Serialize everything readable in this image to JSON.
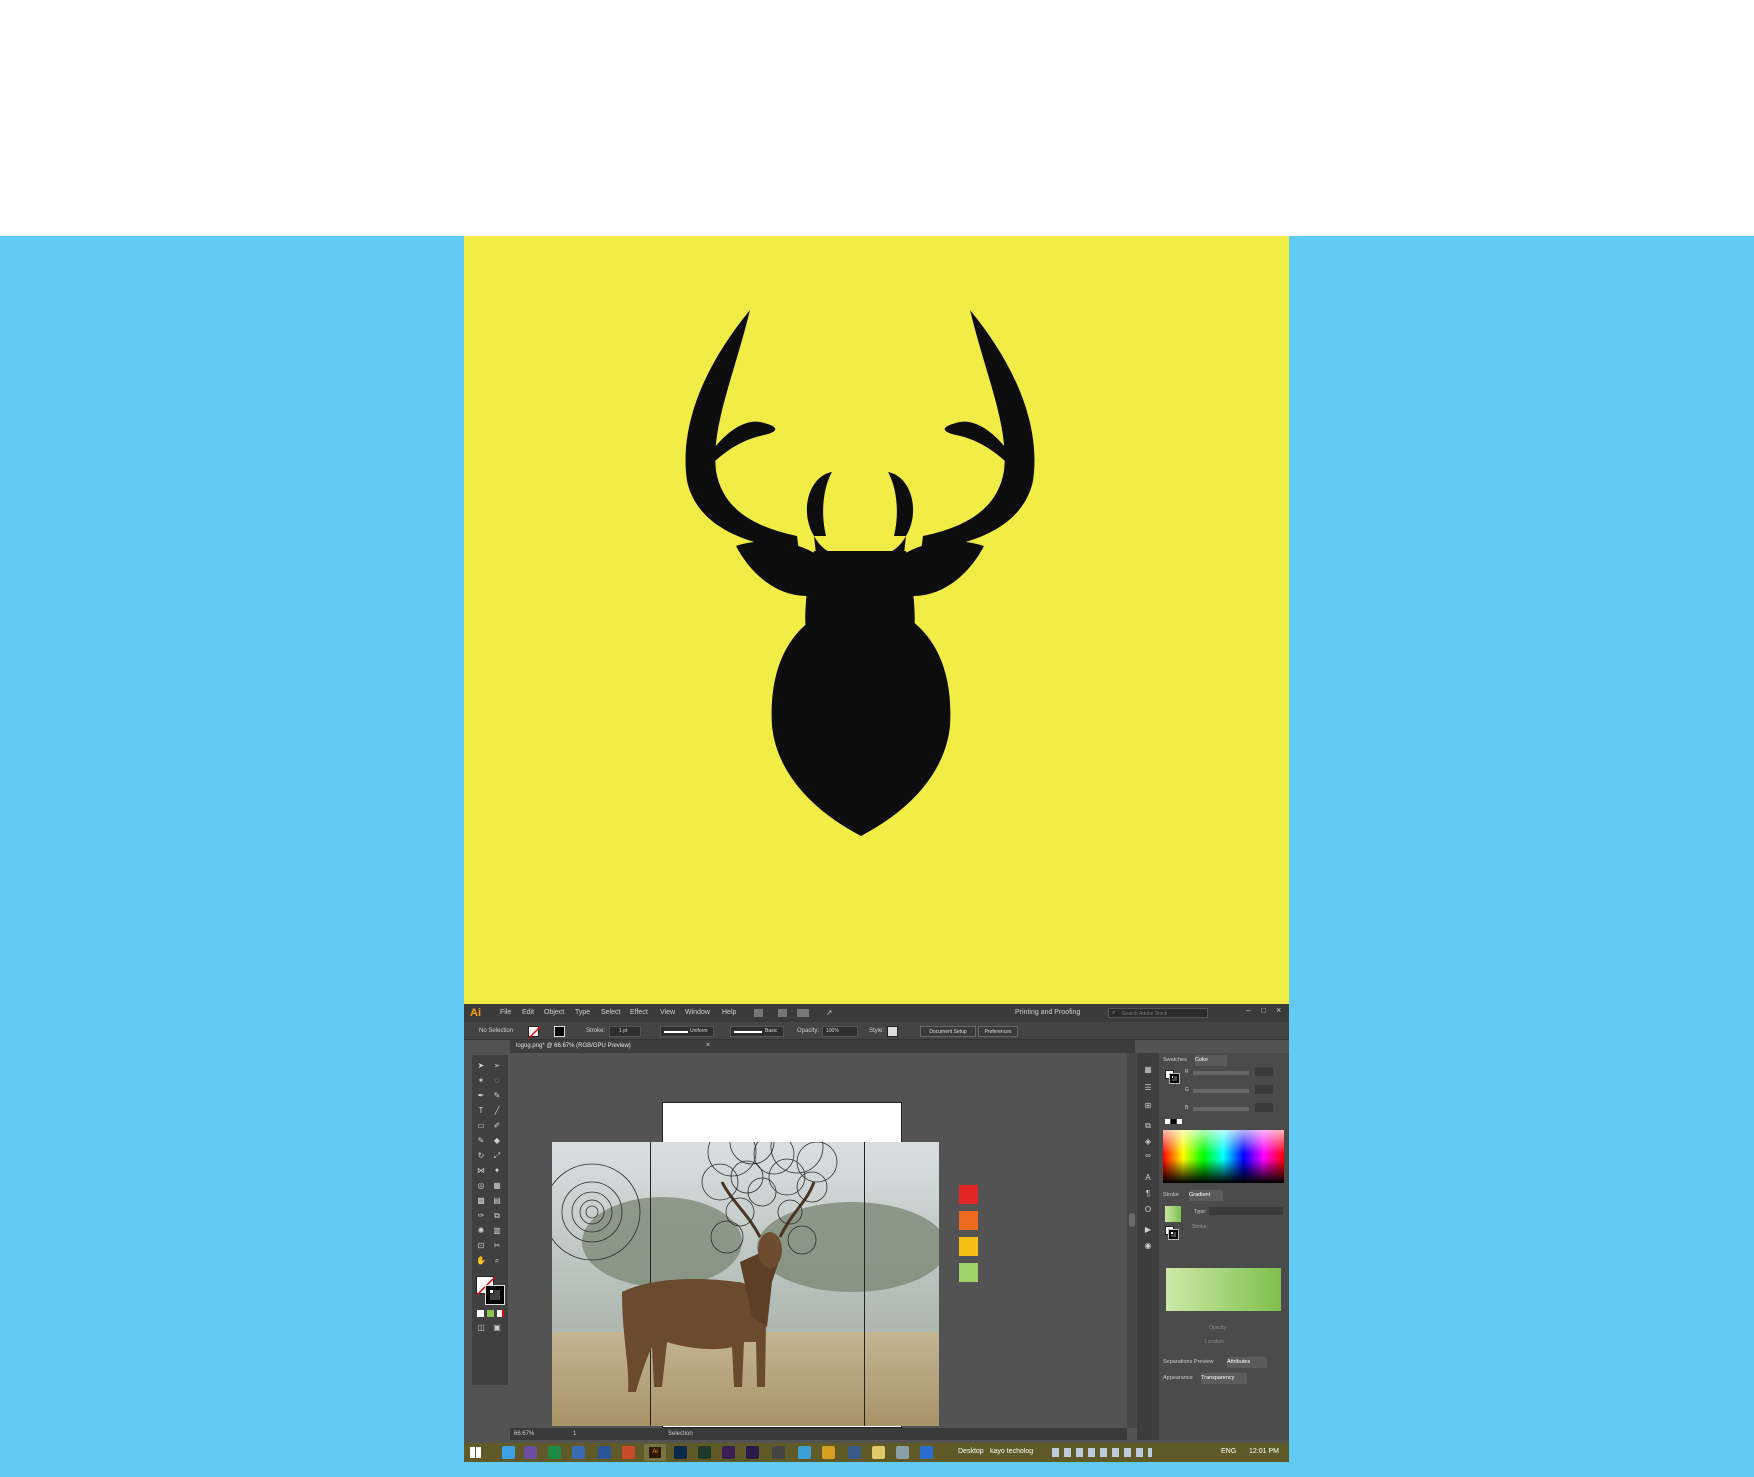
{
  "colors": {
    "background_top": "#ffffff",
    "background_band": "#62cbf5",
    "logo_panel": "#f2ec47",
    "deer_silhouette": "#0e0d0d",
    "swatches": [
      "#e42525",
      "#ee6a1f",
      "#f7bf16",
      "#9fd36a"
    ]
  },
  "illustrator": {
    "menu": [
      "File",
      "Edit",
      "Object",
      "Type",
      "Select",
      "Effect",
      "View",
      "Window",
      "Help"
    ],
    "workspace": "Printing and Proofing",
    "search_placeholder": "Search Adobe Stock",
    "control_bar": {
      "selection": "No Selection",
      "stroke_label": "Stroke:",
      "stroke_weight": "1 pt",
      "stroke_profile": "Uniform",
      "brush": "Basic",
      "opacity_label": "Opacity:",
      "opacity_value": "100%",
      "style_label": "Style:",
      "document_setup": "Document Setup",
      "preferences": "Preferences"
    },
    "document_tab": "logog.png* @ 66.67% (RGB/GPU Preview)",
    "status_bar": {
      "zoom": "66.67%",
      "artboard": "1",
      "tool": "Selection"
    },
    "panels": {
      "top_tabs": [
        "Swatches",
        "Color"
      ],
      "color_channels": [
        "R",
        "G",
        "B"
      ],
      "middle_tabs": [
        "Stroke",
        "Gradient"
      ],
      "gradient_type_label": "Type:",
      "gradient_stroke_label": "Stroke:",
      "opacity_label": "Opacity",
      "location_label": "Location",
      "lower_tabs": [
        "Separations Preview",
        "Attributes"
      ],
      "bottom_tabs": [
        "Appearance",
        "Transparency"
      ]
    }
  },
  "taskbar": {
    "desktop_label": "Desktop",
    "app_label": "kayo techolog",
    "language": "ENG",
    "time": "12:01 PM"
  }
}
